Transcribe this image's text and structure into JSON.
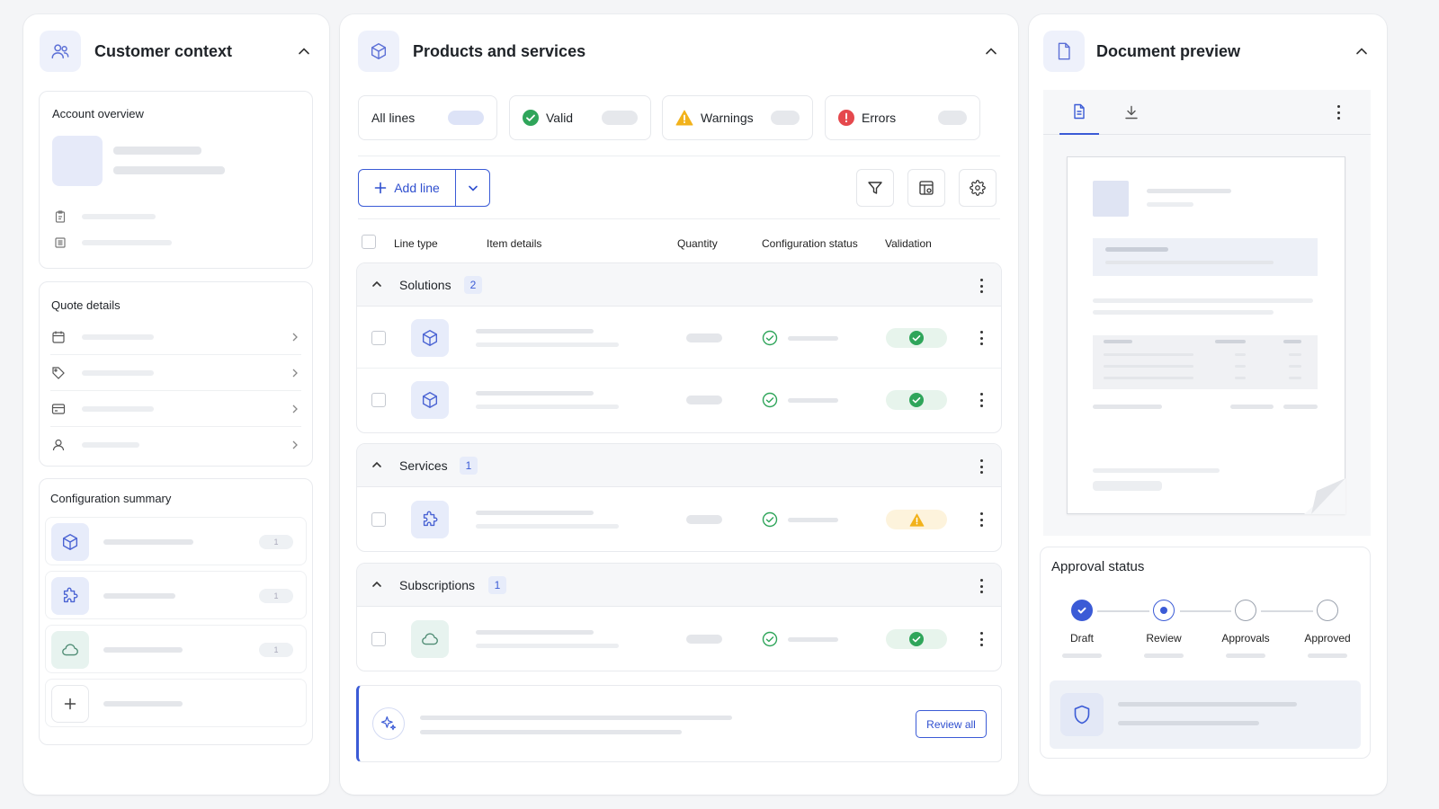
{
  "left": {
    "title": "Customer context",
    "account_overview": {
      "title": "Account overview"
    },
    "quote_details": {
      "title": "Quote details"
    },
    "config_summary": {
      "title": "Configuration summary",
      "counts": [
        "1",
        "1",
        "1"
      ]
    }
  },
  "middle": {
    "title": "Products and services",
    "filters": [
      {
        "label": "All lines"
      },
      {
        "label": "Valid"
      },
      {
        "label": "Warnings"
      },
      {
        "label": "Errors"
      }
    ],
    "add_line_label": "Add line",
    "columns": {
      "line_type": "Line type",
      "item_details": "Item details",
      "quantity": "Quantity",
      "config_status": "Configuration status",
      "validation": "Validation"
    },
    "groups": [
      {
        "name": "Solutions",
        "count": "2"
      },
      {
        "name": "Services",
        "count": "1"
      },
      {
        "name": "Subscriptions",
        "count": "1"
      }
    ],
    "review_all_label": "Review all"
  },
  "right": {
    "title": "Document preview",
    "approval": {
      "title": "Approval status",
      "steps": [
        "Draft",
        "Review",
        "Approvals",
        "Approved"
      ]
    }
  },
  "colors": {
    "accent": "#3b5bd6",
    "valid": "#2fa55a",
    "warning": "#f2b21b",
    "error": "#e5484d"
  }
}
